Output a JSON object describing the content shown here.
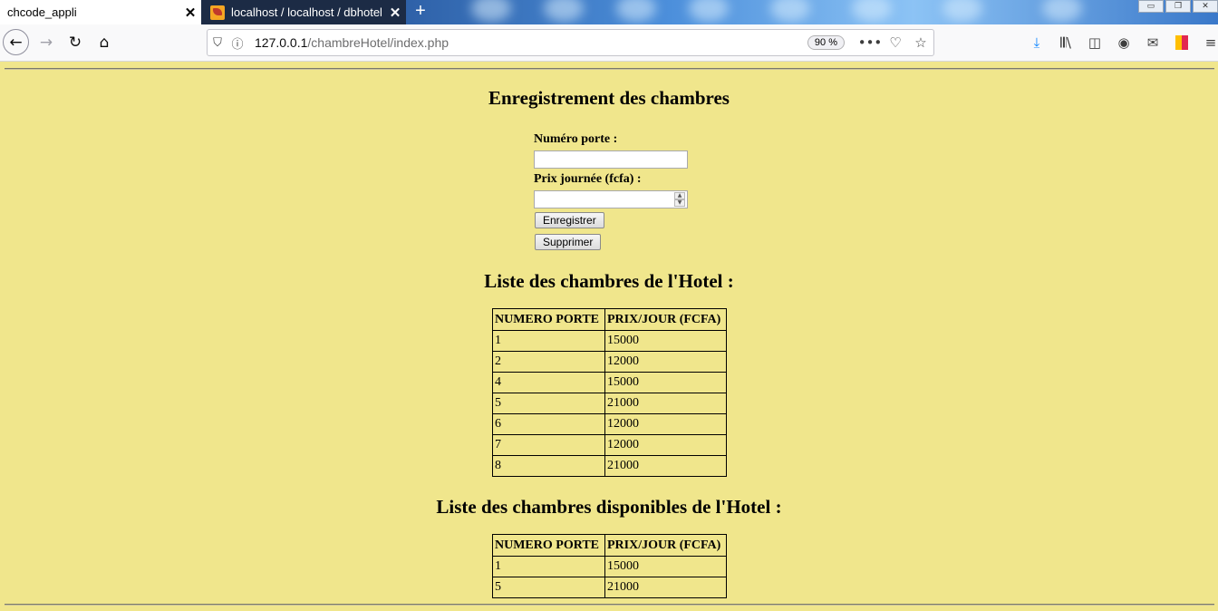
{
  "browser": {
    "tabs": [
      {
        "title": "chcode_appli",
        "active": true
      },
      {
        "title": "localhost / localhost / dbhotel |",
        "active": false
      }
    ],
    "url_host": "127.0.0.1",
    "url_path": "/chambreHotel/index.php",
    "zoom": "90 %"
  },
  "page": {
    "form_title": "Enregistrement des chambres",
    "label_numero": "Numéro porte :",
    "label_prix": "Prix journée (fcfa) :",
    "numero_value": "",
    "prix_value": "",
    "btn_save": "Enregistrer",
    "btn_delete": "Supprimer",
    "list_title": "Liste des chambres de l'Hotel :",
    "avail_title": "Liste des chambres disponibles de l'Hotel :",
    "table_headers": [
      "NUMERO PORTE",
      "PRIX/JOUR (FCFA)"
    ],
    "rooms": [
      {
        "num": "1",
        "prix": "15000"
      },
      {
        "num": "2",
        "prix": "12000"
      },
      {
        "num": "4",
        "prix": "15000"
      },
      {
        "num": "5",
        "prix": "21000"
      },
      {
        "num": "6",
        "prix": "12000"
      },
      {
        "num": "7",
        "prix": "12000"
      },
      {
        "num": "8",
        "prix": "21000"
      }
    ],
    "available": [
      {
        "num": "1",
        "prix": "15000"
      },
      {
        "num": "5",
        "prix": "21000"
      }
    ]
  }
}
